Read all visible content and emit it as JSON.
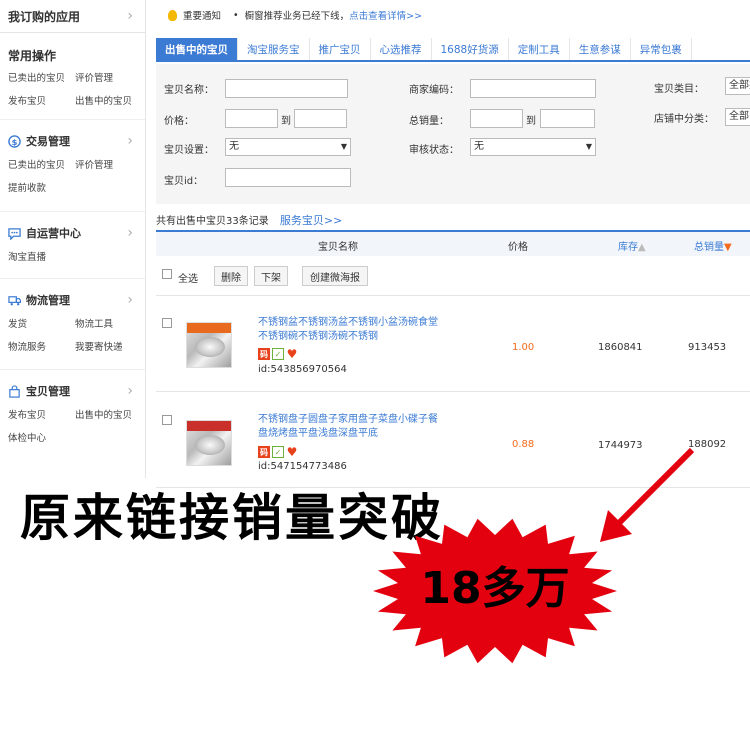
{
  "sidebar": {
    "title": "我订购的应用",
    "sections": [
      {
        "title": "常用操作",
        "links": [
          "已卖出的宝贝",
          "评价管理",
          "发布宝贝",
          "出售中的宝贝"
        ]
      },
      {
        "title": "交易管理",
        "links": [
          "已卖出的宝贝",
          "评价管理",
          "提前收款"
        ]
      },
      {
        "title": "自运营中心",
        "links": [
          "淘宝直播"
        ]
      },
      {
        "title": "物流管理",
        "links": [
          "发货",
          "物流工具",
          "物流服务",
          "我要寄快递"
        ]
      },
      {
        "title": "宝贝管理",
        "links": [
          "发布宝贝",
          "出售中的宝贝",
          "体检中心"
        ]
      }
    ]
  },
  "notice": {
    "label": "重要通知",
    "text": "橱窗推荐业务已经下线，",
    "link": "点击查看详情>>"
  },
  "tabs": [
    "出售中的宝贝",
    "淘宝服务宝",
    "推广宝贝",
    "心选推荐",
    "1688好货源",
    "定制工具",
    "生意参谋",
    "异常包裹"
  ],
  "filter": {
    "item_name_label": "宝贝名称：",
    "merchant_code_label": "商家编码：",
    "category_label": "宝贝类目：",
    "category_value": "全部类",
    "price_label": "价格：",
    "to_label": "到",
    "sales_label": "总销量：",
    "to_label_2": "到",
    "shop_category_label": "店铺中分类：",
    "shop_category_value": "全部",
    "item_setting_label": "宝贝设置：",
    "item_setting_value": "无",
    "audit_label": "审核状态：",
    "audit_value": "无",
    "item_id_label": "宝贝id："
  },
  "summary": {
    "text": "共有出售中宝贝33条记录",
    "link": "服务宝贝>>"
  },
  "table": {
    "headers": {
      "name": "宝贝名称",
      "price": "价格",
      "stock": "库存",
      "sales": "总销量"
    },
    "actions": {
      "select_all": "全选",
      "delete": "删除",
      "offshelf": "下架",
      "create": "创建微海报"
    },
    "rows": [
      {
        "title": "不锈钢盆不锈钢汤盆不锈钢小盆汤碗食堂不锈钢碗不锈钢汤碗不锈钢",
        "badge": "码",
        "id": "id:543856970564",
        "price": "1.00",
        "stock": "1860841",
        "sales": "913453"
      },
      {
        "title": "不锈钢盘子圆盘子家用盘子菜盘小碟子餐盘烧烤盘平盘浅盘深盘平底",
        "badge": "码",
        "id": "id:547154773486",
        "price": "0.88",
        "stock": "1744973",
        "sales": "188092"
      }
    ]
  },
  "promo": {
    "headline": "原来链接销量突破",
    "burst": "18多万"
  },
  "colors": {
    "accent": "#3c7bd4",
    "price": "#f56a1c",
    "burst": "#e3000f"
  }
}
